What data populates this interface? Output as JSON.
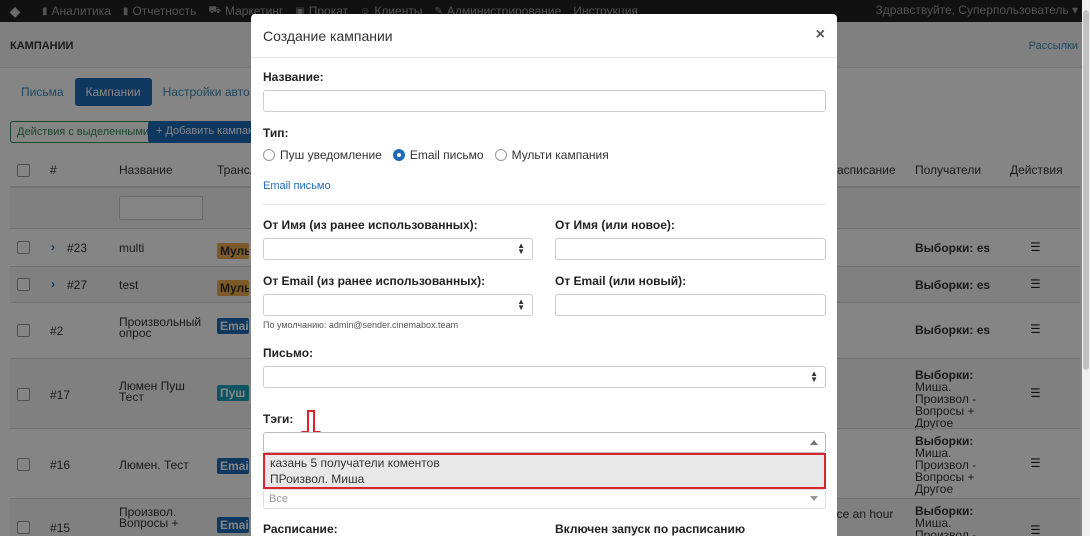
{
  "navbar": {
    "items": [
      {
        "icon": "chart-icon",
        "glyph": "▮",
        "label": "Аналитика"
      },
      {
        "icon": "bar-chart-icon",
        "glyph": "▮",
        "label": "Отчетность"
      },
      {
        "icon": "cart-icon",
        "glyph": "⛟",
        "label": "Маркетинг"
      },
      {
        "icon": "film-icon",
        "glyph": "▣",
        "label": "Прокат"
      },
      {
        "icon": "users-icon",
        "glyph": "☺",
        "label": "Клиенты"
      },
      {
        "icon": "wrench-icon",
        "glyph": "✎",
        "label": "Администрирование"
      },
      {
        "label": "Инструкция"
      }
    ],
    "greeting": "Здравствуйте, Суперпользователь"
  },
  "page": {
    "title": "КАМПАНИИ",
    "header_link": "Рассылки"
  },
  "tabs": [
    {
      "label": "Письма",
      "active": false
    },
    {
      "label": "Кампании",
      "active": true
    },
    {
      "label": "Настройки авто к",
      "active": false
    }
  ],
  "toolbar": {
    "actions_label": "Действия с выделенными",
    "add_label": "+ Добавить кампани"
  },
  "table": {
    "headers": {
      "num": "#",
      "name": "Название",
      "trans": "Трансл",
      "schedule": "асписание",
      "recipients": "Получатели",
      "actions": "Действия"
    },
    "rows": [
      {
        "num": "#23",
        "expand": true,
        "name": "multi",
        "badge": "Мульти",
        "badge_color": "yellow",
        "schedule": "",
        "recipients": "Выборки: es"
      },
      {
        "num": "#27",
        "expand": true,
        "name": "test",
        "badge": "Мульти",
        "badge_color": "yellow",
        "schedule": "",
        "recipients": "Выборки: es"
      },
      {
        "num": "#2",
        "expand": false,
        "name": "Произвольный опрос",
        "badge": "Email пи",
        "badge_color": "blue",
        "schedule": "",
        "recipients": "Выборки: es"
      },
      {
        "num": "#17",
        "expand": false,
        "name": "Люмен Пуш Тест",
        "badge": "Пуш уве",
        "badge_color": "teal",
        "schedule": "",
        "recipients": "Выборки: Миша. Произвол - Вопросы + Другое"
      },
      {
        "num": "#16",
        "expand": false,
        "name": "Люмен. Тест",
        "badge": "Email пи",
        "badge_color": "blue",
        "schedule": "",
        "recipients": "Выборки: Миша. Произвол - Вопросы + Другое"
      },
      {
        "num": "#15",
        "expand": false,
        "name": "Произвол. Вопросы +",
        "badge": "Email пи",
        "badge_color": "blue",
        "schedule": "nce an hour",
        "recipients": "Выборки: Миша. Произвол -"
      }
    ]
  },
  "modal": {
    "title": "Создание кампании",
    "close": "×",
    "name_label": "Название:",
    "name_value": "",
    "type_label": "Тип:",
    "type_options": [
      {
        "label": "Пуш уведомление",
        "checked": false
      },
      {
        "label": "Email письмо",
        "checked": true
      },
      {
        "label": "Мульти кампания",
        "checked": false
      }
    ],
    "type_link": "Email письмо",
    "from_name_prev_label": "От Имя (из ранее использованных):",
    "from_name_new_label": "От Имя (или новое):",
    "from_email_prev_label": "От Email (из ранее использованных):",
    "from_email_new_label": "От Email (или новый):",
    "default_hint": "По умолчанию: admin@sender.cinemabox.team",
    "letter_label": "Письмо:",
    "tags_label": "Тэги:",
    "tags_options": [
      "казань 5 получатели коментов",
      "ПРоизвол. Миша"
    ],
    "all_placeholder": "Все",
    "schedule_label": "Расписание:",
    "schedule_enabled_label": "Включен запуск по расписанию",
    "arrow_color": "#d9232e"
  }
}
